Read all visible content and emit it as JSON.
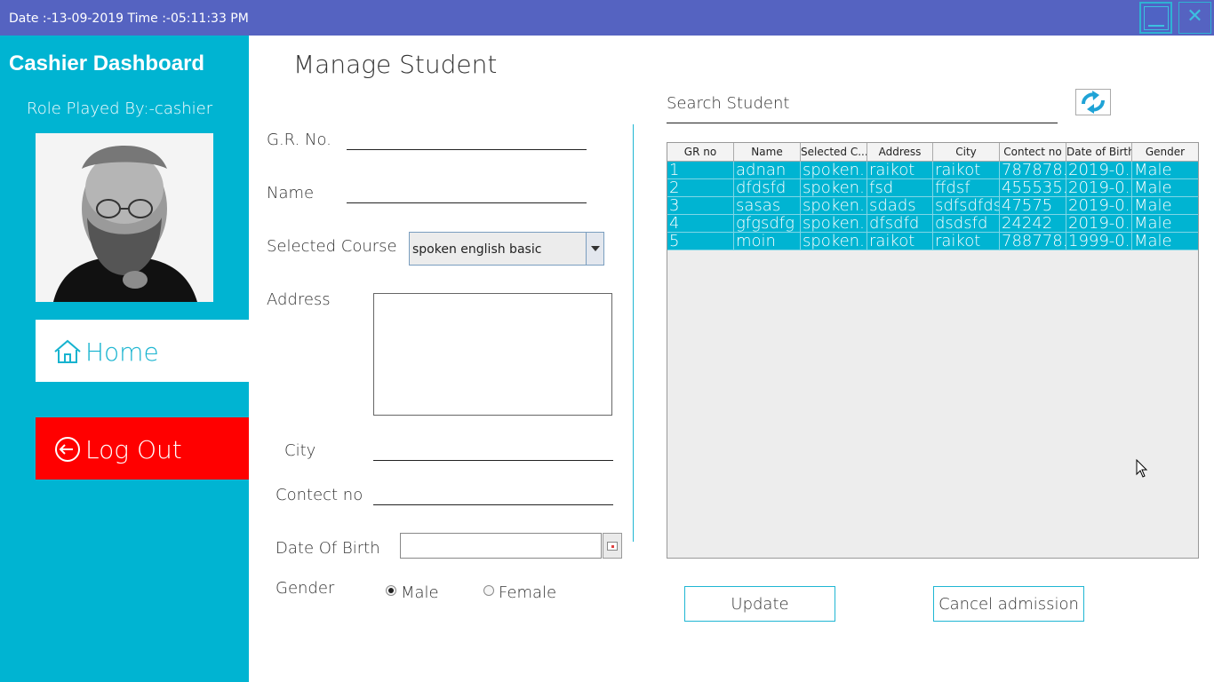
{
  "titlebar": {
    "datetime": "Date :-13-09-2019 Time :-05:11:33 PM",
    "close_glyph": "✕"
  },
  "sidebar": {
    "title": "Cashier Dashboard",
    "role": "Role Played By:-cashier",
    "home_label": "Home",
    "logout_label": "Log Out",
    "accent": "#00b4d2",
    "logout_color": "#ff0000"
  },
  "form": {
    "title": "Manage Student",
    "gr_label": "G.R. No.",
    "name_label": "Name",
    "course_label": "Selected Course",
    "course_value": "spoken english basic",
    "address_label": "Address",
    "city_label": "City",
    "contact_label": "Contect no",
    "dob_label": "Date Of Birth",
    "gender_label": "Gender",
    "gender_male": "Male",
    "gender_female": "Female",
    "gender_selected": "Male"
  },
  "search": {
    "label": "Search Student"
  },
  "table": {
    "columns": [
      "GR no",
      "Name",
      "Selected C...",
      "Address",
      "City",
      "Contect no",
      "Date of Birth",
      "Gender"
    ],
    "rows": [
      [
        "1",
        "adnan",
        "spoken...",
        "raikot",
        "raikot",
        "787878...",
        "2019-0...",
        "Male"
      ],
      [
        "2",
        "dfdsfd",
        "spoken...",
        "fsd",
        "ffdsf",
        "455535...",
        "2019-0...",
        "Male"
      ],
      [
        "3",
        "sasas",
        "spoken...",
        "sdads",
        "sdfsdfds",
        "47575",
        "2019-0...",
        "Male"
      ],
      [
        "4",
        "gfgsdfg",
        "spoken...",
        "dfsdfd",
        "dsdsfd",
        "24242",
        "2019-0...",
        "Male"
      ],
      [
        "5",
        "moin",
        "spoken...",
        "raikot",
        "raikot",
        "788778...",
        "1999-0...",
        "Male"
      ]
    ],
    "row_color": "#00b4d2"
  },
  "actions": {
    "update_label": "Update",
    "cancel_label": "Cancel admission"
  }
}
